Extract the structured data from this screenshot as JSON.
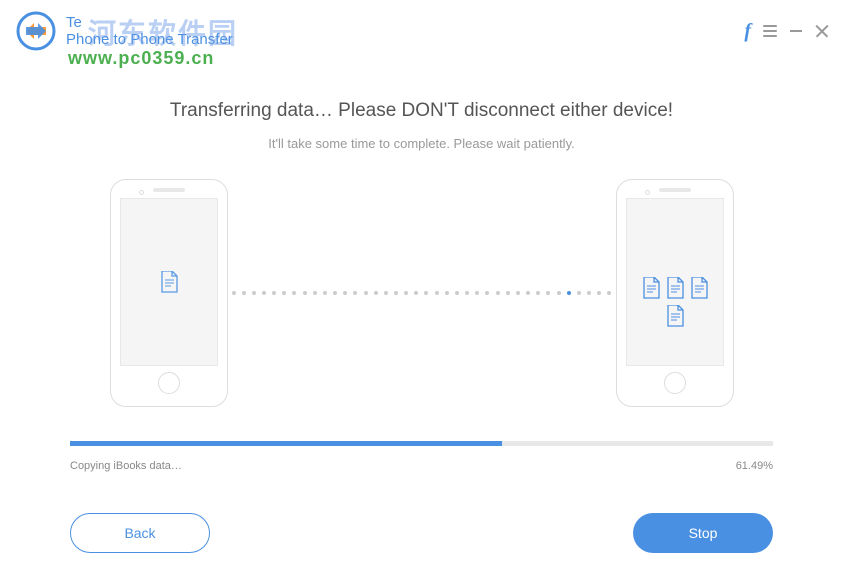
{
  "app": {
    "title": "Phone to Phone Transfer",
    "vendor_prefix": "Te"
  },
  "watermark": {
    "chinese": "河东软件园",
    "url": "www.pc0359.cn"
  },
  "transfer": {
    "heading": "Transferring data… Please DON'T disconnect either device!",
    "subheading": "It'll take some time to complete. Please wait patiently."
  },
  "progress": {
    "status_text": "Copying iBooks data…",
    "percent_text": "61.49%",
    "percent_value": 61.49
  },
  "buttons": {
    "back": "Back",
    "stop": "Stop"
  },
  "colors": {
    "primary": "#4a90e2",
    "text_muted": "#999",
    "text_body": "#555"
  },
  "icons": {
    "source_count": 1,
    "target_count": 4
  }
}
